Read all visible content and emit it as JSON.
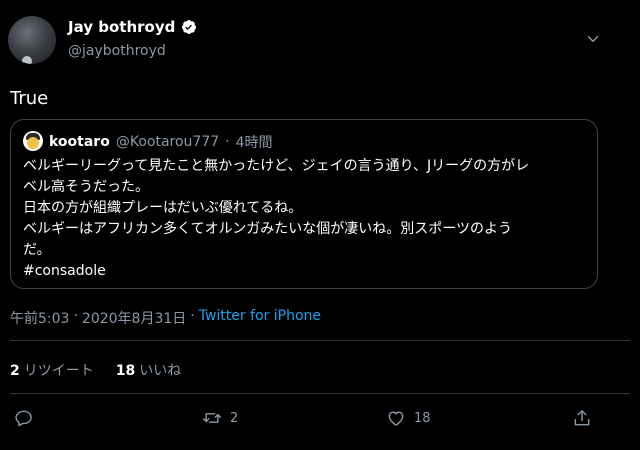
{
  "author": {
    "display_name": "Jay bothroyd",
    "handle": "@jaybothroyd"
  },
  "tweet": {
    "text": "True"
  },
  "quoted_tweet": {
    "display_name": "kootaro",
    "handle": "@Kootarou777",
    "separator": "·",
    "time": "4時間",
    "lines": [
      "ベルギーリーグって見たこと無かったけど、ジェイの言う通り、Jリーグの方がレ",
      "ベル高そうだった。",
      "日本の方が組織プレーはだいぶ優れてるね。",
      "ベルギーはアフリカン多くてオルンガみたいな個が凄いね。別スポーツのよう",
      "だ。",
      "#consadole"
    ]
  },
  "meta": {
    "time": "午前5:03",
    "separator1": "·",
    "date": "2020年8月31日",
    "separator2": "·",
    "source": "Twitter for iPhone"
  },
  "stats": {
    "retweets_count": "2",
    "retweets_label": "リツイート",
    "likes_count": "18",
    "likes_label": "いいね"
  },
  "actions": {
    "retweet_count": "2",
    "like_count": "18"
  },
  "icons": [
    "verified-badge-icon",
    "chevron-down-icon",
    "reply-icon",
    "retweet-icon",
    "like-icon",
    "share-icon"
  ],
  "colors": {
    "background": "#000000",
    "link": "#1da1f2",
    "secondary_text": "#8b98a5",
    "border": "#38444d"
  }
}
